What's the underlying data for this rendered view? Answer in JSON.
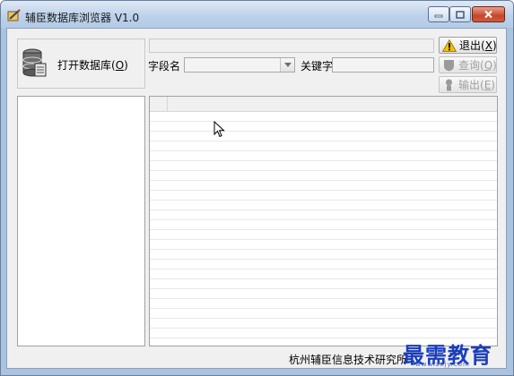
{
  "window": {
    "title": "辅臣数据库浏览器 V1.0"
  },
  "db_panel": {
    "open_label": "打开数据库",
    "open_hotkey": "O"
  },
  "search": {
    "field_label": "字段名",
    "field_value": "",
    "keyword_label": "关键字",
    "keyword_value": ""
  },
  "buttons": {
    "exit_label": "退出",
    "exit_hotkey": "X",
    "query_label": "查询",
    "query_hotkey": "Q",
    "export_label": "输出",
    "export_hotkey": "E"
  },
  "status": {
    "text": "杭州辅臣信息技术研究所"
  },
  "watermark": {
    "text": "最需教育",
    "url": "www.zxjy.com"
  },
  "colors": {
    "title_bar": "#bdd2ea",
    "close_button": "#c6452a",
    "warning_icon": "#f2c200",
    "watermark": "#1a3dbd"
  },
  "icons": {
    "app": "pencil-notebook-icon",
    "database": "database-stack-icon",
    "exit": "warning-triangle-icon",
    "query": "query-shield-icon",
    "export": "export-person-icon",
    "dropdown": "chevron-down-icon",
    "cursor": "mouse-pointer-icon"
  }
}
